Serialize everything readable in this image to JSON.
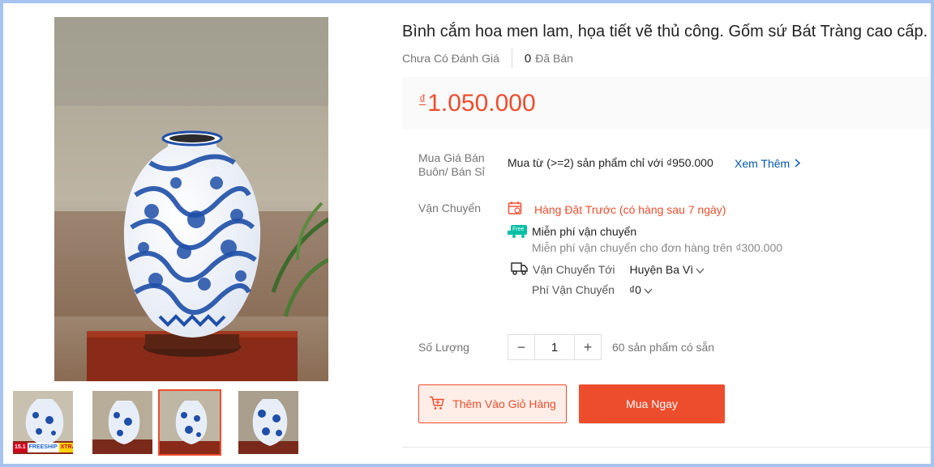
{
  "product": {
    "title": "Bình cắm hoa men lam, họa tiết vẽ thủ công. Gốm sứ Bát Tràng cao cấp.",
    "rating_text": "Chưa Có Đánh Giá",
    "sold_count": "0",
    "sold_label": "Đã Bán",
    "currency": "₫",
    "price": "1.050.000"
  },
  "wholesale": {
    "label": "Mua Giá Bán Buôn/ Bán Sỉ",
    "text": "Mua từ (>=2) sản phẩm chỉ với ₫950.000",
    "see_more": "Xem Thêm"
  },
  "shipping": {
    "label": "Vận Chuyển",
    "preorder": "Hàng Đặt Trước (có hàng sau 7 ngày)",
    "free_badge": "Free",
    "free_title": "Miễn phí vận chuyển",
    "free_note": "Miễn phí vận chuyển cho đơn hàng trên ₫300.000",
    "ship_to_label": "Vận Chuyển Tới",
    "ship_to_value": "Huyện Ba Vì",
    "fee_label": "Phí Vận Chuyển",
    "fee_value": "₫0"
  },
  "quantity": {
    "label": "Số Lượng",
    "minus": "−",
    "value": "1",
    "plus": "+",
    "stock": "60 sản phẩm có sẵn"
  },
  "actions": {
    "add_to_cart": "Thêm Vào Giỏ Hàng",
    "buy_now": "Mua Ngay"
  },
  "thumbnail_badge": {
    "date": "15.1",
    "brand": "FREESHIP",
    "tag": "XTRA"
  },
  "colors": {
    "accent": "#ee4d2d",
    "accent_light": "#ffeee8",
    "link": "#0055aa",
    "free_green": "#00bfa5",
    "vase_blue": "#1f4fa8"
  }
}
